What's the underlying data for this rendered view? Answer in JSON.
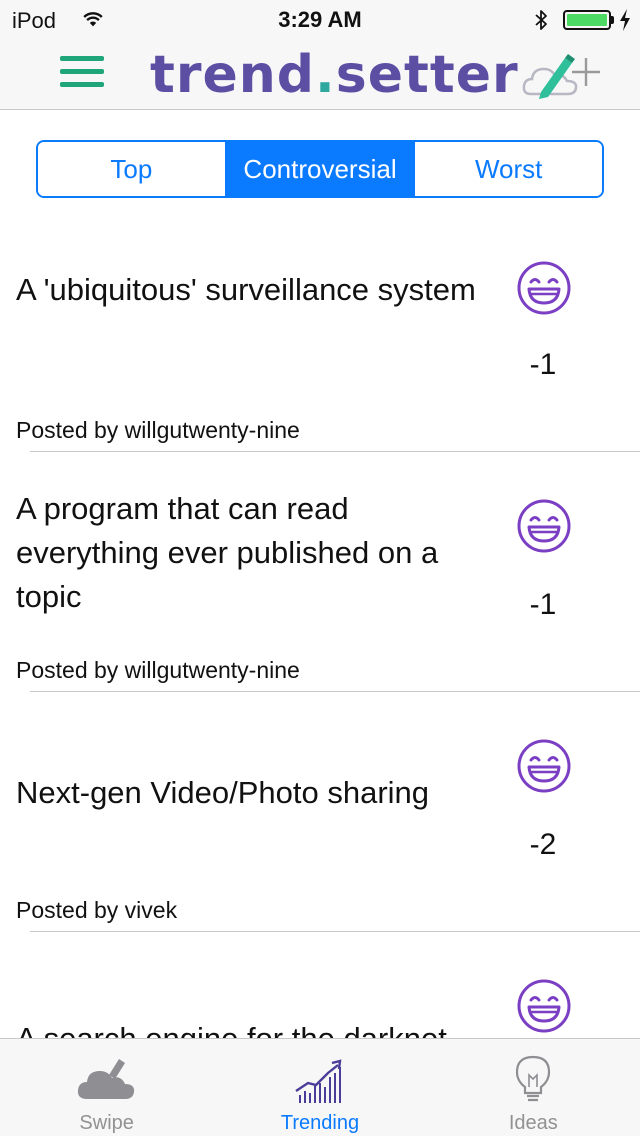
{
  "status_bar": {
    "carrier": "iPod",
    "time": "3:29 AM"
  },
  "nav": {
    "logo_part1": "trend",
    "logo_dot": ".",
    "logo_part2": "setter",
    "brand_color": "#5b4ea3",
    "accent_color": "#1fa57a"
  },
  "segments": [
    {
      "label": "Top",
      "active": false
    },
    {
      "label": "Controversial",
      "active": true
    },
    {
      "label": "Worst",
      "active": false
    }
  ],
  "ideas": [
    {
      "title": "A 'ubiquitous' surveillance system",
      "score": "-1",
      "posted_by": "Posted by willgutwenty-nine"
    },
    {
      "title": "A program that can read everything ever published on a topic",
      "score": "-1",
      "posted_by": "Posted by willgutwenty-nine"
    },
    {
      "title": "Next-gen Video/Photo sharing",
      "score": "-2",
      "posted_by": "Posted by vivek"
    },
    {
      "title": "A search engine for the darknet",
      "score": "",
      "posted_by": ""
    }
  ],
  "tabs": [
    {
      "label": "Swipe",
      "icon": "cloud-icon",
      "active": false
    },
    {
      "label": "Trending",
      "icon": "trending-chart-icon",
      "active": true
    },
    {
      "label": "Ideas",
      "icon": "lightbulb-icon",
      "active": false
    }
  ],
  "colors": {
    "tint": "#0a7aff",
    "vote_icon": "#7b3fc4",
    "inactive_tab": "#929292"
  }
}
